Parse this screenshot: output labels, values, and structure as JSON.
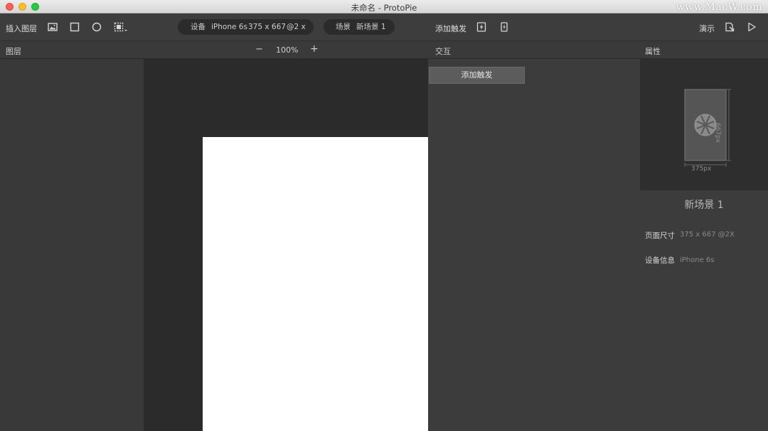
{
  "window": {
    "title": "未命名 - ProtoPie",
    "watermark": "www.MacW.com"
  },
  "toolbar": {
    "insert_layer_label": "插入图层",
    "device_label": "设备",
    "device_name": "iPhone 6s",
    "device_size": "375 x 667",
    "device_scale": "@2 x",
    "scene_label": "场景",
    "scene_name": "新场景 1",
    "add_trigger_label": "添加触发",
    "present_label": "演示"
  },
  "sections": {
    "layers": "图层",
    "zoom_minus": "−",
    "zoom_level": "100%",
    "zoom_plus": "+",
    "interaction": "交互",
    "properties": "属性"
  },
  "interaction": {
    "add_trigger_button": "添加触发"
  },
  "properties": {
    "preview_width": "375px",
    "preview_height": "667px",
    "scene_name": "新场景 1",
    "page_size_label": "页面尺寸",
    "page_size_value": "375 x 667 @2X",
    "device_info_label": "设备信息",
    "device_info_value": "iPhone 6s"
  }
}
